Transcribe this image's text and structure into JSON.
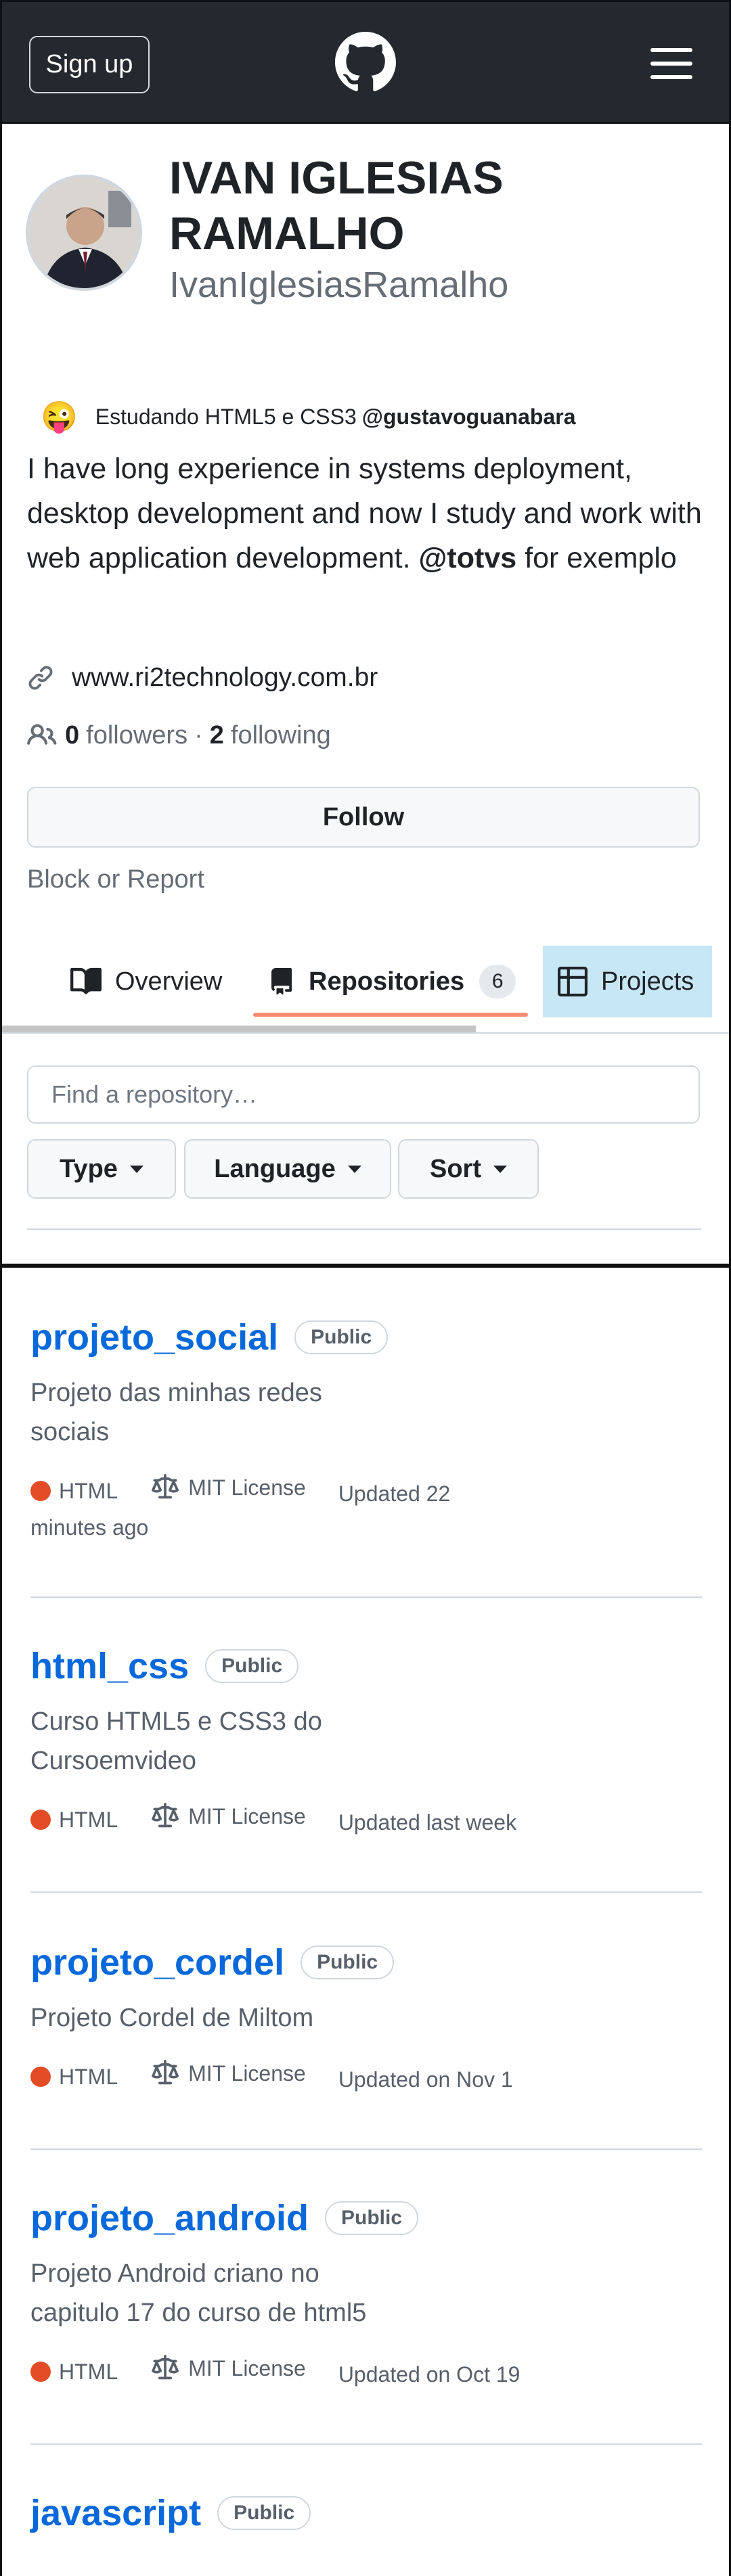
{
  "header": {
    "signup_label": "Sign up",
    "logo_icon": "github-mark-icon",
    "menu_icon": "hamburger-menu-icon"
  },
  "profile": {
    "name": "IVAN IGLESIAS RAMALHO",
    "login": "IvanIglesiasRamalho",
    "status_emoji": "😜",
    "status_text": "Estudando HTML5 e CSS3",
    "status_mention": "@gustavoguanabara",
    "bio_text": "I have long experience in systems deployment, desktop development and now I study and work with web application development.",
    "bio_mention": "@totvs",
    "bio_after": "for exemplo",
    "website": "www.ri2technology.com.br",
    "followers_count": "0",
    "followers_label": "followers",
    "separator": "·",
    "following_count": "2",
    "following_label": "following",
    "follow_button": "Follow",
    "block_report": "Block or Report"
  },
  "tabs": {
    "overview": "Overview",
    "repositories": "Repositories",
    "repositories_count": "6",
    "projects": "Projects"
  },
  "filters": {
    "search_placeholder": "Find a repository…",
    "type": "Type",
    "language": "Language",
    "sort": "Sort"
  },
  "repos": [
    {
      "name": "projeto_social",
      "visibility": "Public",
      "description": "Projeto das minhas redes sociais",
      "language": "HTML",
      "license": "MIT License",
      "updated": "Updated 22 minutes ago"
    },
    {
      "name": "html_css",
      "visibility": "Public",
      "description": "Curso HTML5 e CSS3 do Cursoemvideo",
      "language": "HTML",
      "license": "MIT License",
      "updated": "Updated last week"
    },
    {
      "name": "projeto_cordel",
      "visibility": "Public",
      "description": "Projeto Cordel de Miltom",
      "language": "HTML",
      "license": "MIT License",
      "updated": "Updated on Nov 1"
    },
    {
      "name": "projeto_android",
      "visibility": "Public",
      "description": "Projeto Android criano no capitulo 17 do curso de html5",
      "language": "HTML",
      "license": "MIT License",
      "updated": "Updated on Oct 19"
    },
    {
      "name": "javascript",
      "visibility": "Public"
    }
  ],
  "colors": {
    "header_bg": "#24292f",
    "link": "#0969da",
    "html_lang": "#e34c26",
    "tab_highlight": "#c8e7f4",
    "underline": "#fd8c73"
  }
}
